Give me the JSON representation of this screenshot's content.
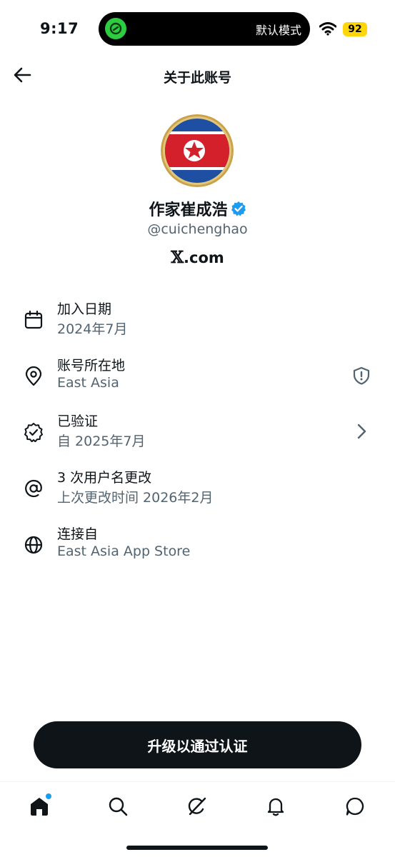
{
  "status_bar": {
    "time": "9:17",
    "island_text": "默认模式",
    "battery": "92",
    "colors": {
      "battery": "#ffd60a",
      "island_icon": "#2ecc40"
    }
  },
  "header": {
    "title": "关于此账号",
    "back_icon": "arrow-left-icon"
  },
  "profile": {
    "display_name": "作家崔成浩",
    "verified_icon": "verified-badge-icon",
    "handle": "@cuichenghao",
    "brand_x": "𝕏",
    "brand_com": ".com"
  },
  "info": [
    {
      "icon": "calendar-icon",
      "title": "加入日期",
      "subtitle": "2024年7月"
    },
    {
      "icon": "location-pin-icon",
      "title": "账号所在地",
      "subtitle": "East Asia",
      "trailing_icon": "shield-alert-icon"
    },
    {
      "icon": "verified-check-icon",
      "title": "已验证",
      "subtitle": "自 2025年7月",
      "trailing_icon": "chevron-right-icon"
    },
    {
      "icon": "at-sign-icon",
      "title": "3 次用户名更改",
      "subtitle": "上次更改时间 2026年2月"
    },
    {
      "icon": "globe-icon",
      "title": "连接自",
      "subtitle": "East Asia App Store"
    }
  ],
  "cta": {
    "label": "升级以通过认证"
  },
  "bottom_nav": [
    {
      "name": "home",
      "icon": "home-icon",
      "badge": true
    },
    {
      "name": "search",
      "icon": "search-icon"
    },
    {
      "name": "grok",
      "icon": "grok-icon"
    },
    {
      "name": "notifications",
      "icon": "bell-icon"
    },
    {
      "name": "messages",
      "icon": "message-icon"
    }
  ],
  "colors": {
    "accent": "#1d9bf0",
    "text": "#0f1419",
    "secondary": "#536471",
    "button": "#0f1419"
  }
}
